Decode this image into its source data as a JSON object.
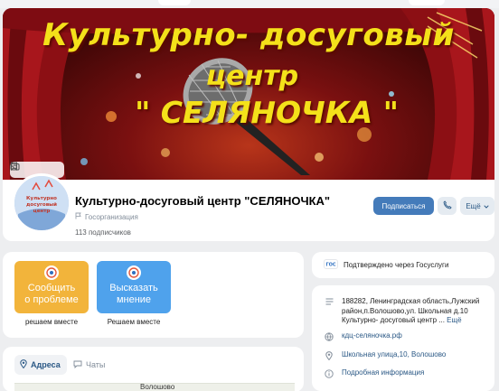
{
  "cover": {
    "title_line1": "Культурно- досуговый",
    "title_line2": "центр",
    "title_line3": "\" СЕЛЯНОЧКА \""
  },
  "cover_tools": [
    "bookmark-icon",
    "camera-icon",
    "more-vertical-icon"
  ],
  "avatar": {
    "text": "Культурно досуговый центр"
  },
  "profile": {
    "name": "Культурно-досуговый центр \"СЕЛЯНОЧКА\"",
    "type": "Госорганизация",
    "subscribers": "113 подписчиков"
  },
  "buttons": {
    "subscribe": "Подписаться",
    "more": "Ещё"
  },
  "actions": [
    {
      "label_1": "Сообщить",
      "label_2": "о проблеме",
      "sub": "решаем вместе"
    },
    {
      "label_1": "Высказать",
      "label_2": "мнение",
      "sub": "Решаем вместе"
    }
  ],
  "tabs": {
    "address": "Адреса",
    "chats": "Чаты"
  },
  "map": {
    "label": "Волошово"
  },
  "gosuslugi": {
    "badge": "ГОС",
    "text": "Подтверждено через Госуслуги"
  },
  "info": {
    "address": "188282, Ленинградская область,Лужский район,п.Волошово,ул. Школьная д.10 Культурно- досуговый центр ...",
    "address_more": "Ещё",
    "site": "кдц-селяночка.рф",
    "location": "Школьная улица,10, Волошово",
    "details": "Подробная информация"
  },
  "colors": {
    "accent": "#447bba",
    "link": "#2a5885",
    "yellow_button": "#f2b43b",
    "blue_button": "#4fa2ec",
    "cover_text": "#f4e11a"
  }
}
